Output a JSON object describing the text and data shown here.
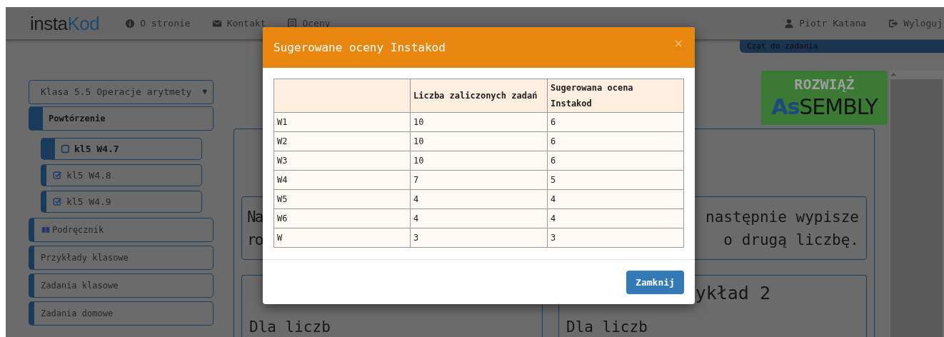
{
  "header": {
    "logo_prefix": "insta",
    "logo_suffix": "Kod",
    "nav": [
      {
        "label": "O stronie",
        "kind": "info"
      },
      {
        "label": "Kontakt",
        "kind": "mail"
      },
      {
        "label": "Oceny",
        "kind": "list"
      }
    ],
    "user": "Piotr Katana",
    "logout": "Wyloguj"
  },
  "chat_tab": "Czat do zadania",
  "sidebar": {
    "lesson_select": "Klasa 5.5 Operacje arytmety",
    "select_arrow": "▼",
    "items": [
      {
        "label": "Powtórzenie",
        "kind": "plain",
        "selected": true,
        "children": [
          {
            "label": "kl5 W4.7",
            "checked": false,
            "selected": true
          },
          {
            "label": "kl5 W4.8",
            "checked": true,
            "selected": false
          },
          {
            "label": "kl5 W4.9",
            "checked": true,
            "selected": false
          }
        ]
      },
      {
        "label": "Podręcznik",
        "kind": "book",
        "selected": false
      },
      {
        "label": "Przykłady klasowe",
        "kind": "plain",
        "selected": false
      },
      {
        "label": "Zadania klasowe",
        "kind": "plain",
        "selected": false
      },
      {
        "label": "Zadania domowe",
        "kind": "plain",
        "selected": false
      }
    ]
  },
  "solve_button": {
    "title": "ROZWIĄŻ",
    "prefix": "As",
    "rest": "SEMBLY"
  },
  "task_lines": [
    {
      "left": "Na",
      "right": "następnie wypisze"
    },
    {
      "left": "ro",
      "right": "o drugą liczbę."
    }
  ],
  "examples": [
    {
      "body": "Dla liczb"
    },
    {
      "title": "ykład 2",
      "body": "Dla liczb"
    }
  ],
  "modal": {
    "title": "Sugerowane oceny Instakod",
    "close": "×",
    "columns": [
      "",
      "Liczba zaliczonych zadań",
      "Sugerowana ocena Instakod"
    ],
    "rows": [
      [
        "W1",
        "10",
        "6"
      ],
      [
        "W2",
        "10",
        "6"
      ],
      [
        "W3",
        "10",
        "6"
      ],
      [
        "W4",
        "7",
        "5"
      ],
      [
        "W5",
        "4",
        "4"
      ],
      [
        "W6",
        "4",
        "4"
      ],
      [
        "W",
        "3",
        "3"
      ]
    ],
    "button": "Zamknij"
  }
}
